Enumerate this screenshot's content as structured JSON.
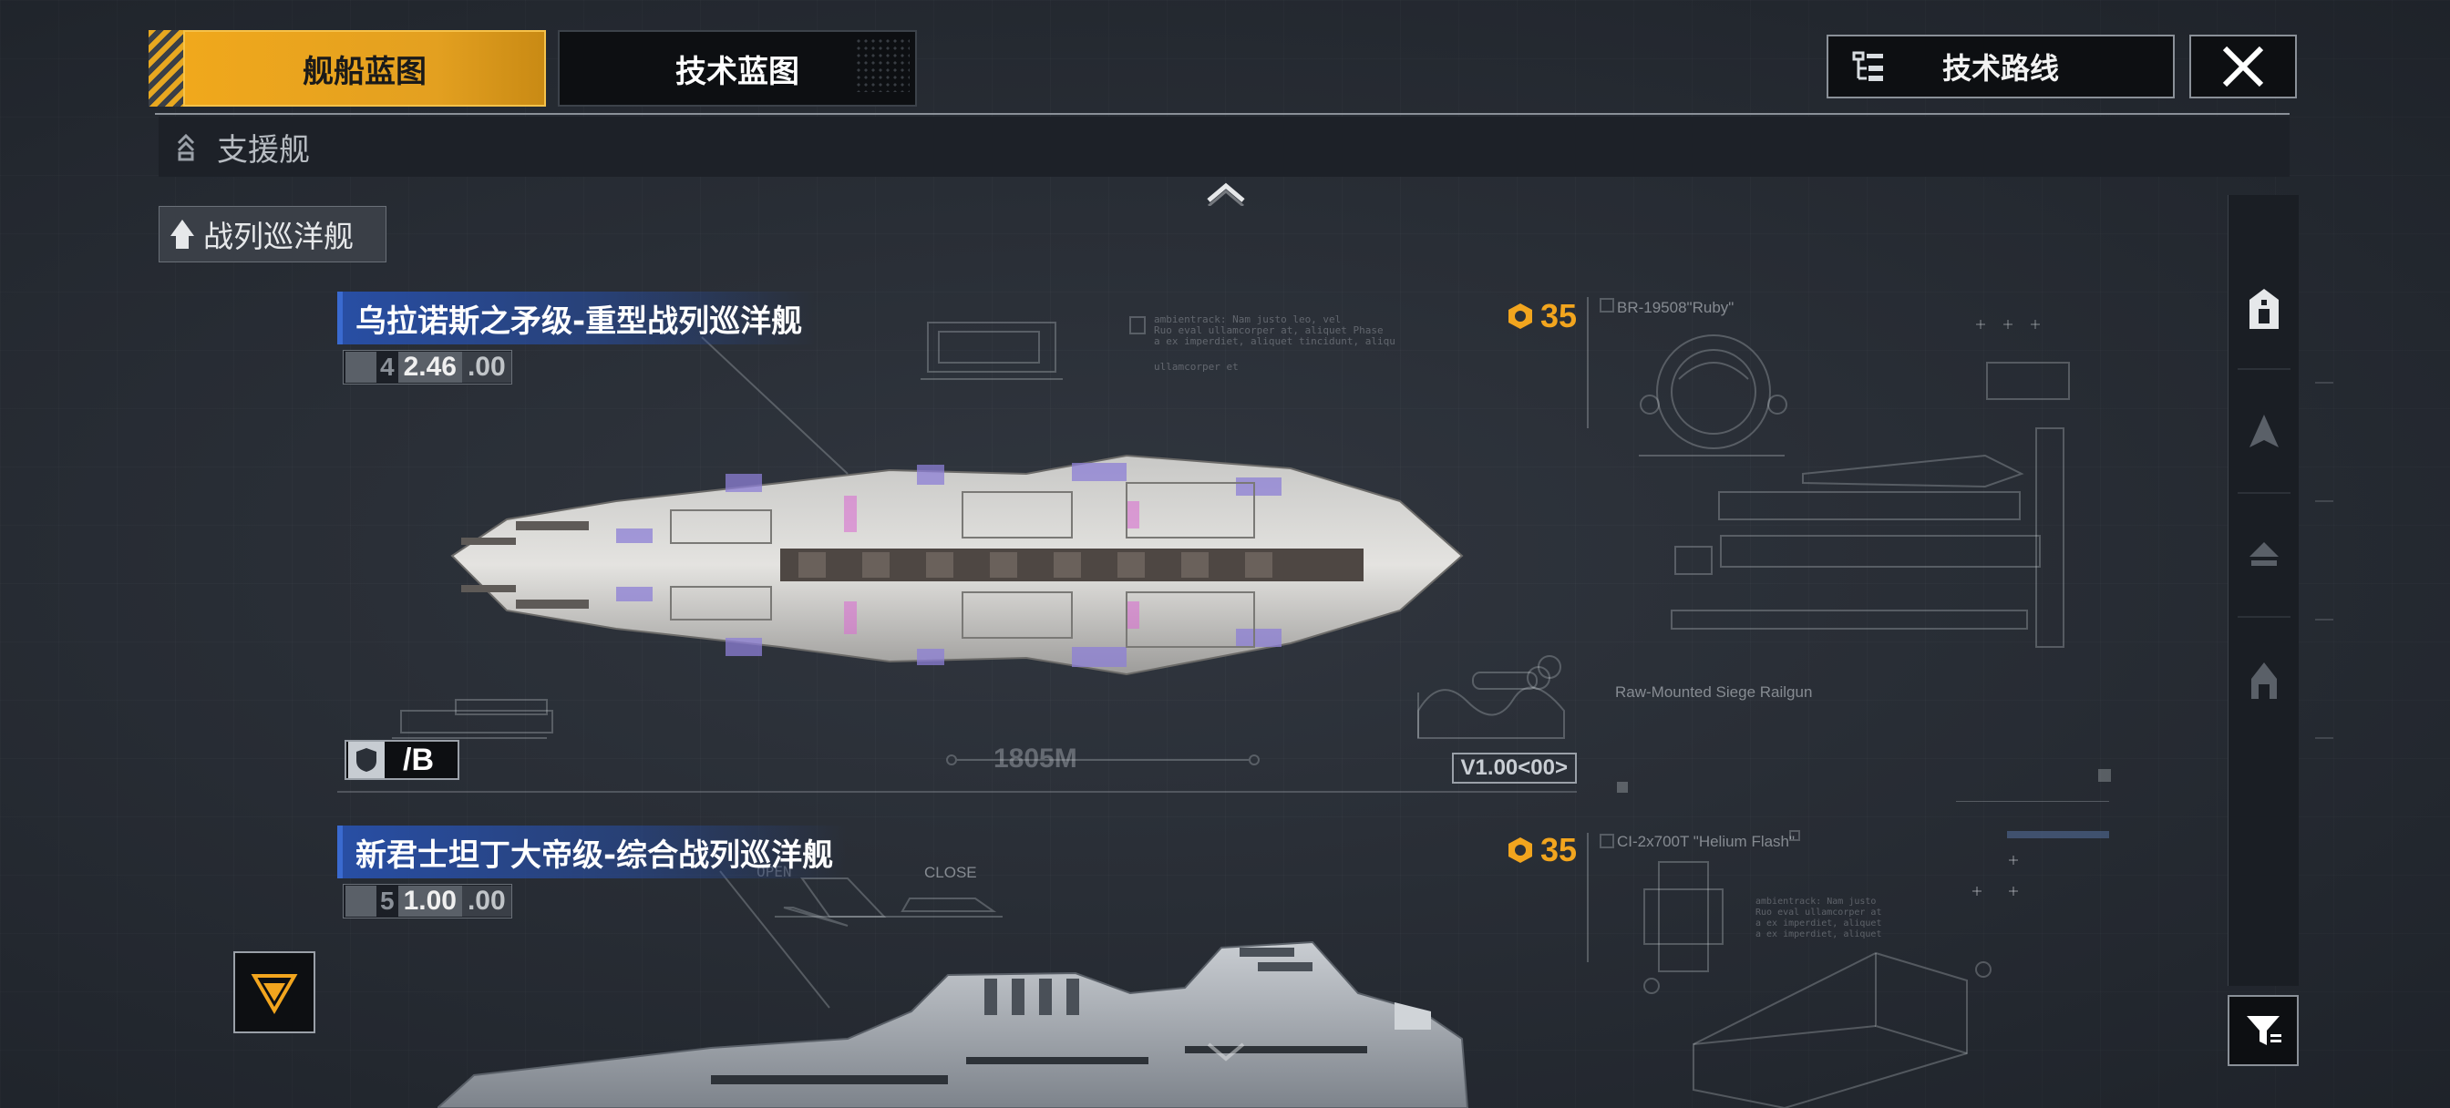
{
  "tabs": {
    "ship_blueprint": "舰船蓝图",
    "tech_blueprint": "技术蓝图"
  },
  "tech_route_label": "技术路线",
  "category": {
    "label": "支援舰",
    "sub_label": "战列巡洋舰"
  },
  "ships": [
    {
      "name": "乌拉诺斯之矛级-重型战列巡洋舰",
      "tier": "4",
      "version": "2.46",
      "version_suffix": ".00",
      "cost": "35",
      "grade": "/B",
      "length": "1805M",
      "model_version": "V1.00<00>",
      "weapon_code": "BR-19508\"Ruby\"",
      "weapon_name": "Raw-Mounted Siege Railgun"
    },
    {
      "name": "新君士坦丁大帝级-综合战列巡洋舰",
      "tier": "5",
      "version": "1.00",
      "version_suffix": ".00",
      "cost": "35",
      "weapon_code": "CI-2x700T \"Helium Flash\""
    }
  ],
  "blueprint_labels": {
    "open": "OPEN",
    "close": "CLOSE"
  },
  "colors": {
    "accent": "#f0a81c",
    "title_blue": "#2850aa",
    "cost": "#f2a51e"
  }
}
